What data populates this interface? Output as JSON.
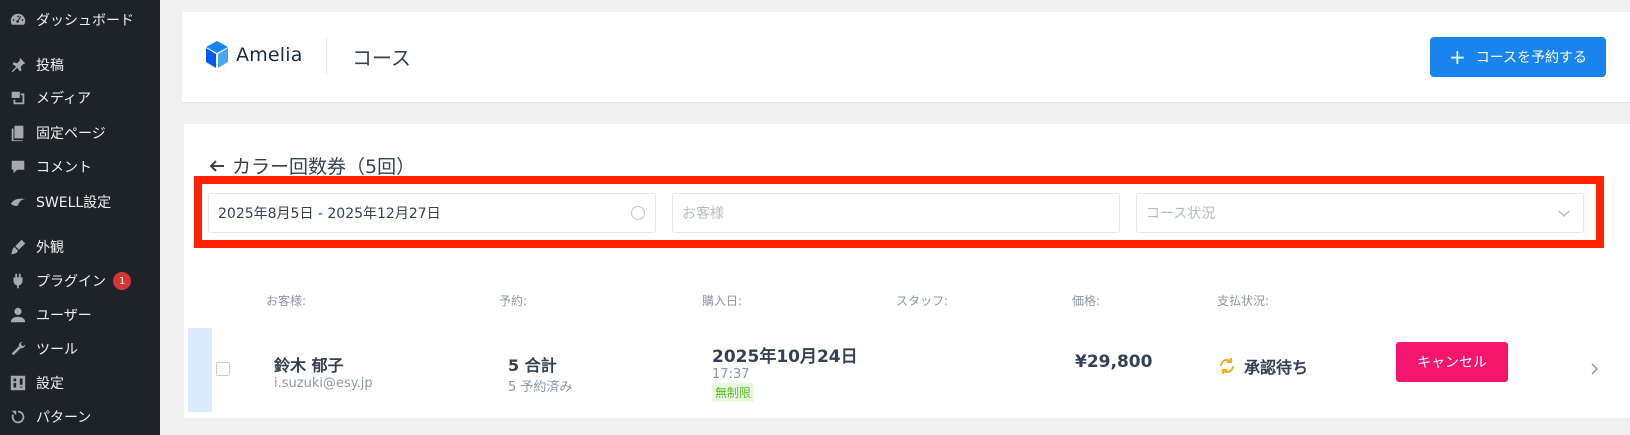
{
  "sidebar": {
    "items": [
      {
        "label": "ダッシュボード",
        "icon": "dashboard-icon"
      },
      {
        "label": "投稿",
        "icon": "pin-icon"
      },
      {
        "label": "メディア",
        "icon": "media-icon"
      },
      {
        "label": "固定ページ",
        "icon": "pages-icon"
      },
      {
        "label": "コメント",
        "icon": "comment-icon"
      },
      {
        "label": "SWELL設定",
        "icon": "swell-icon"
      },
      {
        "label": "外観",
        "icon": "brush-icon"
      },
      {
        "label": "プラグイン",
        "icon": "plugin-icon",
        "badge": "1"
      },
      {
        "label": "ユーザー",
        "icon": "user-icon"
      },
      {
        "label": "ツール",
        "icon": "wrench-icon"
      },
      {
        "label": "設定",
        "icon": "settings-icon"
      },
      {
        "label": "パターン",
        "icon": "pattern-icon"
      }
    ]
  },
  "header": {
    "logo_text": "Amelia",
    "title": "コース",
    "book_button": "コースを予約する"
  },
  "course": {
    "title": "カラー回数券（5回）"
  },
  "filters": {
    "date_range": "2025年8月5日 - 2025年12月27日",
    "customer_placeholder": "お客様",
    "status_placeholder": "コース状況"
  },
  "table": {
    "headers": {
      "customer": "お客様:",
      "booking": "予約:",
      "purchase_date": "購入日:",
      "staff": "スタッフ:",
      "price": "価格:",
      "payment_status": "支払状況:"
    },
    "rows": [
      {
        "customer_name": "鈴木 郁子",
        "customer_email": "i.suzuki@esy.jp",
        "booking_total": "5 合計",
        "booking_booked": "5 予約済み",
        "purchase_date": "2025年10月24日",
        "purchase_time": "17:37",
        "validity": "無制限",
        "price": "¥29,800",
        "payment_status": "承認待ち",
        "cancel_label": "キャンセル"
      }
    ]
  },
  "colors": {
    "primary": "#1a84ee",
    "cancel": "#f3166c",
    "highlight": "#ff2200",
    "sidebar_bg": "#1d2327"
  }
}
